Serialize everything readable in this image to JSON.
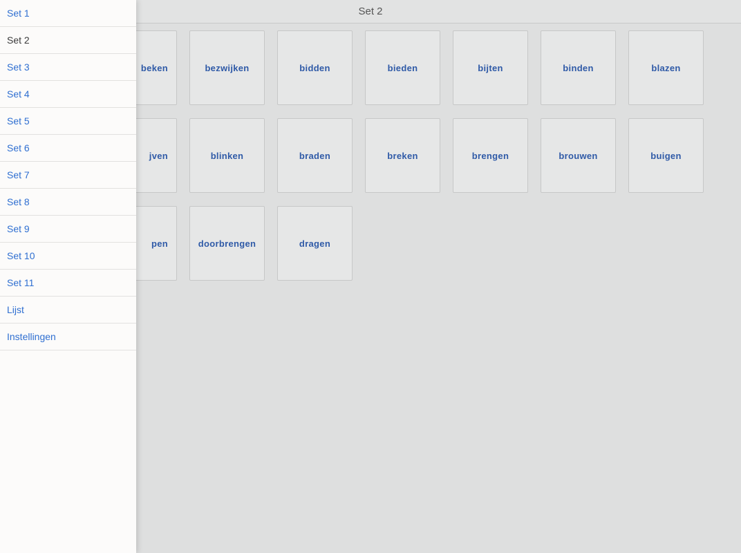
{
  "header": {
    "title": "Set 2"
  },
  "sidebar": {
    "items": [
      {
        "label": "Set 1",
        "selected": false
      },
      {
        "label": "Set 2",
        "selected": true
      },
      {
        "label": "Set 3",
        "selected": false
      },
      {
        "label": "Set 4",
        "selected": false
      },
      {
        "label": "Set 5",
        "selected": false
      },
      {
        "label": "Set 6",
        "selected": false
      },
      {
        "label": "Set 7",
        "selected": false
      },
      {
        "label": "Set 8",
        "selected": false
      },
      {
        "label": "Set 9",
        "selected": false
      },
      {
        "label": "Set 10",
        "selected": false
      },
      {
        "label": "Set 11",
        "selected": false
      },
      {
        "label": "Lijst",
        "selected": false
      },
      {
        "label": "Instellingen",
        "selected": false
      }
    ]
  },
  "grid": {
    "rows": [
      [
        "beken",
        "bezwijken",
        "bidden",
        "bieden",
        "bijten",
        "binden",
        "blazen"
      ],
      [
        "jven",
        "blinken",
        "braden",
        "breken",
        "brengen",
        "brouwen",
        "buigen"
      ],
      [
        "pen",
        "doorbrengen",
        "dragen"
      ]
    ]
  }
}
